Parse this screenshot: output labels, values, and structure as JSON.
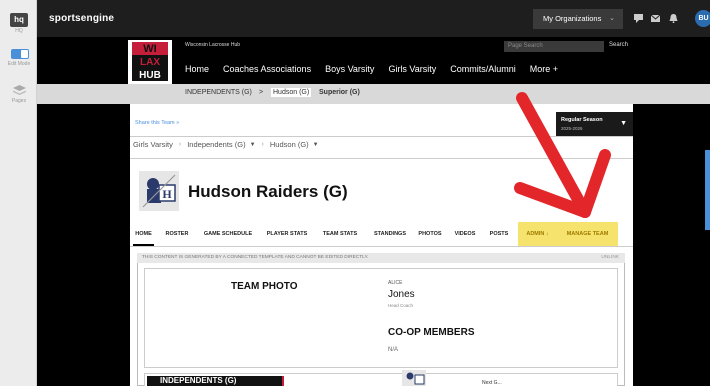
{
  "left_rail": {
    "hq_label": "hq",
    "hq_caption": "HQ",
    "edit_caption": "Edit Mode",
    "pages_caption": "Pages"
  },
  "topbar": {
    "brand": "sportsengine",
    "my_orgs": "My Organizations",
    "avatar_initials": "BU"
  },
  "site": {
    "org_name": "Wisconsin Lacrosse Hub",
    "logo_text": "WI LAX HUB",
    "search_placeholder": "Page Search",
    "search_button": "Search",
    "nav": [
      "Home",
      "Coaches Associations",
      "Boys Varsity",
      "Girls Varsity",
      "Commits/Alumni",
      "More +"
    ]
  },
  "breadcrumb": [
    "INDEPENDENTS (G)",
    "Hudson (G)",
    "Superior (G)"
  ],
  "breadcrumb_sep": ">",
  "page": {
    "share": "Share this Team »",
    "season_label": "Regular Season",
    "season_years": "2025-2026",
    "crumbs": [
      "Girls Varsity",
      "Independents (G)",
      "Hudson (G)"
    ],
    "team_name": "Hudson Raiders (G)",
    "tabs": [
      "HOME",
      "ROSTER",
      "GAME SCHEDULE",
      "PLAYER STATS",
      "TEAM STATS",
      "STANDINGS",
      "PHOTOS",
      "VIDEOS",
      "POSTS",
      "ADMIN ↓",
      "MANAGE TEAM"
    ],
    "notice": "THIS CONTENT IS GENERATED BY A CONNECTED TEMPLATE AND CANNOT BE EDITED DIRECTLY.",
    "unlink": "UNLINK",
    "team_photo_heading": "TEAM PHOTO",
    "coach_first": "ALICE",
    "coach_last": "Jones",
    "coach_title": "Head Coach",
    "coop_heading": "CO-OP MEMBERS",
    "coop_value": "N/A",
    "banner_text": "INDEPENDENTS (G)",
    "next_game": "Next G..."
  },
  "colors": {
    "accent": "#f5e36d",
    "arrow": "#e3262a",
    "link": "#4a90d9"
  }
}
